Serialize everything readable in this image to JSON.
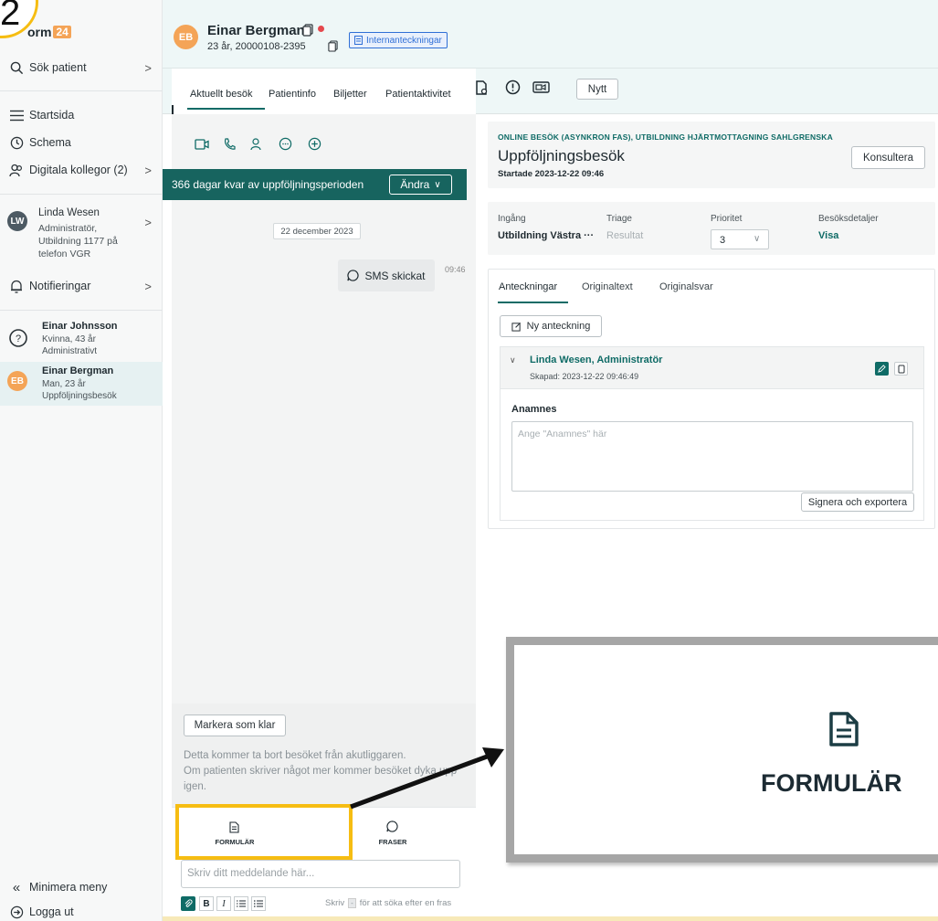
{
  "step_badge": "2",
  "sidebar": {
    "logo_text": "orm",
    "logo_badge": "24",
    "search_patient": "Sök patient",
    "start_page": "Startsida",
    "schedule": "Schema",
    "digital_colleagues": "Digitala kollegor (2)",
    "user": {
      "initials": "LW",
      "name": "Linda Wesen",
      "role": "Administratör,",
      "org1": "Utbildning 1177 på",
      "org2": "telefon VGR"
    },
    "notifications": "Notifieringar",
    "patients": [
      {
        "name": "Einar Johnsson",
        "line1": "Kvinna, 43 år",
        "line2": "Administrativt"
      },
      {
        "initials": "EB",
        "name": "Einar Bergman",
        "line1": "Man, 23 år",
        "line2": "Uppföljningsbesök"
      }
    ],
    "minimize_menu": "Minimera meny",
    "logout": "Logga ut"
  },
  "header": {
    "initials": "EB",
    "patient_name": "Einar Bergman",
    "patient_meta": "23 år, 20000108-2395",
    "internal_notes": "Internanteckningar"
  },
  "tabs": {
    "items": [
      "Aktuellt besök",
      "Patientinfo",
      "Biljetter",
      "Patientaktivitet"
    ],
    "new_button": "Nytt"
  },
  "chat": {
    "banner_text": "366 dagar kvar av uppföljningsperioden",
    "change_button": "Ändra",
    "date_chip": "22 december 2023",
    "sms_label": "SMS skickat",
    "sms_time": "09:46",
    "mark_done_button": "Markera som klar",
    "info_text_1": "Detta kommer ta bort besöket från akutliggaren.",
    "info_text_2": "Om patienten skriver något mer kommer besöket dyka upp",
    "info_text_3": "igen.",
    "form_tab": "FORMULÄR",
    "phrases_tab": "FRASER",
    "message_placeholder": "Skriv ditt meddelande här...",
    "hint_prefix": "Skriv",
    "hint_key": "-",
    "hint_suffix": "för att söka efter en fras"
  },
  "visit": {
    "category": "ONLINE BESÖK (ASYNKRON FAS), UTBILDNING HJÄRTMOTTAGNING SAHLGRENSKA",
    "title": "Uppföljningsbesök",
    "started": "Startade 2023-12-22 09:46",
    "consult_button": "Konsultera",
    "fields": {
      "entry_label": "Ingång",
      "entry_value": "Utbildning Västra ···",
      "triage_label": "Triage",
      "triage_value": "Resultat",
      "priority_label": "Prioritet",
      "priority_value": "3",
      "details_label": "Besöksdetaljer",
      "details_value": "Visa"
    }
  },
  "notes": {
    "tabs": [
      "Anteckningar",
      "Originaltext",
      "Originalsvar"
    ],
    "new_note_button": "Ny anteckning",
    "author": "Linda Wesen, Administratör",
    "created": "Skapad: 2023-12-22 09:46:49",
    "section_label": "Anamnes",
    "anamnes_placeholder": "Ange \"Anamnes\" här",
    "sign_button": "Signera och exportera"
  },
  "zoom": {
    "label": "FORMULÄR"
  },
  "colors": {
    "brand_teal": "#0f6b66",
    "banner": "#17645f",
    "highlight_yellow": "#f6bd12",
    "orange": "#f4a457",
    "red_dot": "#e5484d",
    "link_blue": "#2f6fd6"
  }
}
